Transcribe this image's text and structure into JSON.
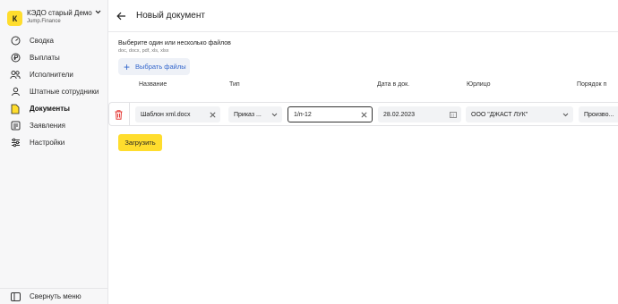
{
  "org": {
    "badge": "К",
    "name": "КЭДО старый Демо",
    "subtitle": "Jump.Finance"
  },
  "sidebar": {
    "items": [
      {
        "label": "Сводка",
        "icon": "dashboard-icon",
        "active": false
      },
      {
        "label": "Выплаты",
        "icon": "ruble-icon",
        "active": false
      },
      {
        "label": "Исполнители",
        "icon": "users-icon",
        "active": false
      },
      {
        "label": "Штатные сотрудники",
        "icon": "user-icon",
        "active": false
      },
      {
        "label": "Документы",
        "icon": "document-icon",
        "active": true
      },
      {
        "label": "Заявления",
        "icon": "list-icon",
        "active": false
      },
      {
        "label": "Настройки",
        "icon": "sliders-icon",
        "active": false
      }
    ],
    "collapse_label": "Свернуть меню"
  },
  "header": {
    "title": "Новый документ"
  },
  "upload": {
    "hint": "Выберите один или несколько файлов",
    "formats": "doc, docx, pdf, xls, xlsx",
    "pick_label": "Выбрать файлы"
  },
  "table": {
    "columns": [
      "Название",
      "Тип",
      "Дата в док.",
      "Юрлицо",
      "Порядок п"
    ],
    "row": {
      "name": "Шаблон xml.docx",
      "type": "Приказ ...",
      "number": "1/п-12",
      "date": "28.02.2023",
      "entity": "ООО \"ДЖАСТ ЛУК\"",
      "order": "Произво..."
    }
  },
  "submit_label": "Загрузить",
  "colors": {
    "accent": "#ffdd2d",
    "link": "#3366cc",
    "danger": "#e53935"
  }
}
